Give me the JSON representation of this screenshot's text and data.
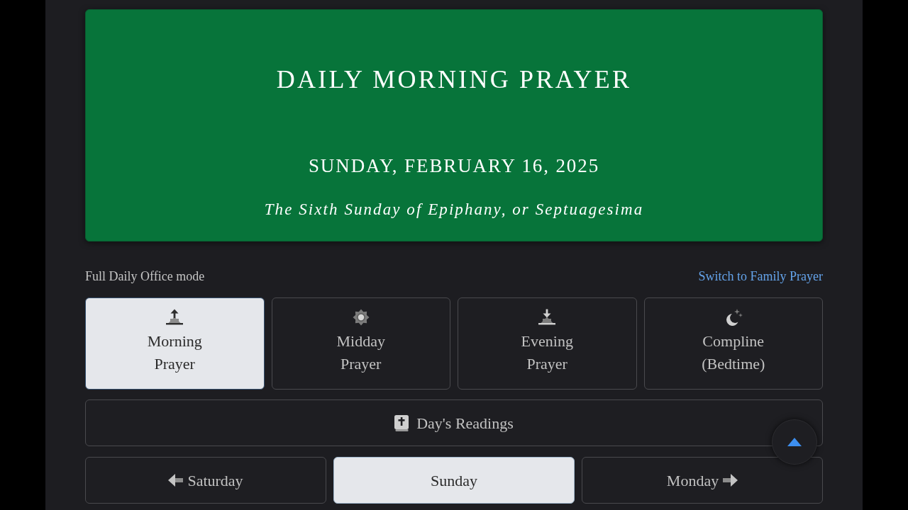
{
  "header": {
    "title": "DAILY MORNING PRAYER",
    "date": "SUNDAY, FEBRUARY 16, 2025",
    "observance": "The Sixth Sunday of Epiphany, or Septuagesima"
  },
  "mode": {
    "label": "Full Daily Office mode",
    "switch_link": "Switch to Family Prayer"
  },
  "offices": [
    {
      "kind": "sunrise",
      "label": "Morning Prayer",
      "selected": true
    },
    {
      "kind": "sun",
      "label": "Midday Prayer",
      "selected": false
    },
    {
      "kind": "sunset",
      "label": "Evening Prayer",
      "selected": false
    },
    {
      "kind": "moon",
      "label": "Compline (Bedtime)",
      "selected": false
    }
  ],
  "readings_button": {
    "label": "Day's Readings"
  },
  "day_nav": [
    {
      "kind": "previous",
      "label": "Saturday",
      "selected": false
    },
    {
      "kind": "current",
      "label": "Sunday",
      "selected": true
    },
    {
      "kind": "next",
      "label": "Monday",
      "selected": false
    }
  ]
}
